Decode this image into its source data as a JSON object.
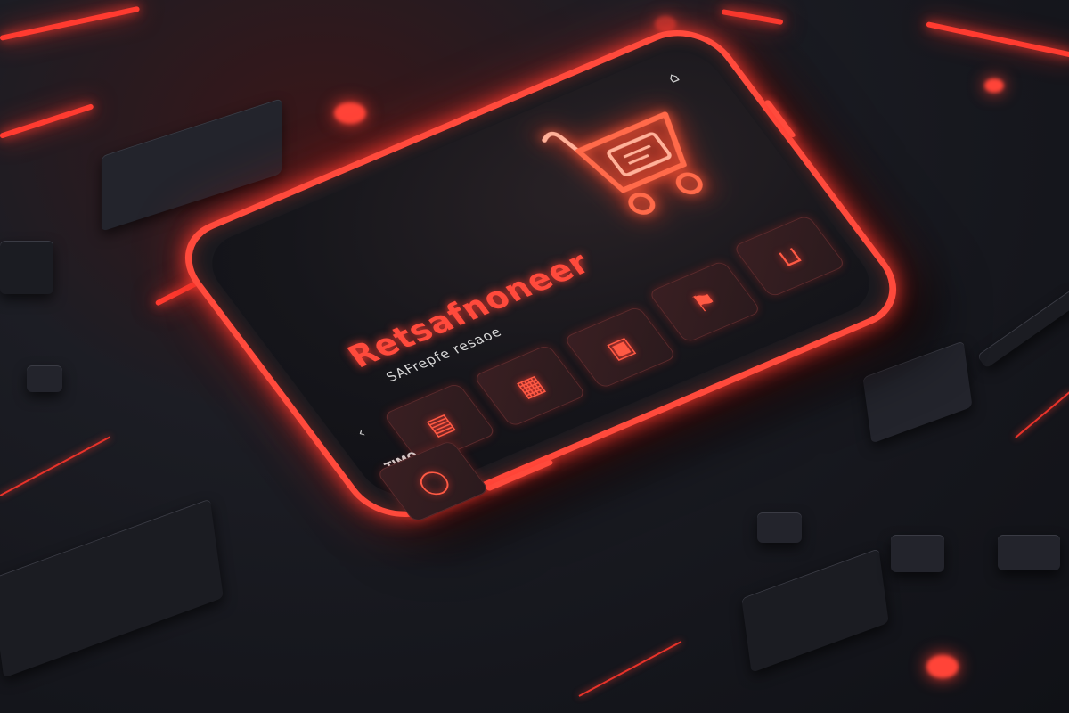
{
  "phone": {
    "status_left": "",
    "title": "Retsafnoneer",
    "subtitle": "SAFrepfe resaoe",
    "bottom_left_label": "TIMO"
  },
  "tiles": [
    {
      "icon": "receipt-icon",
      "glyph": "▤",
      "label": ""
    },
    {
      "icon": "cart-box-icon",
      "glyph": "▦",
      "label": ""
    },
    {
      "icon": "clipboard-icon",
      "glyph": "▣",
      "label": ""
    },
    {
      "icon": "flag-icon",
      "glyph": "⚑",
      "label": ""
    },
    {
      "icon": "basket-icon",
      "glyph": "⊔",
      "label": ""
    },
    {
      "icon": "circle-icon",
      "glyph": "◯",
      "label": ""
    }
  ],
  "colors": {
    "accent": "#ff4a3c",
    "background": "#15161c",
    "screen": "#16161b"
  }
}
